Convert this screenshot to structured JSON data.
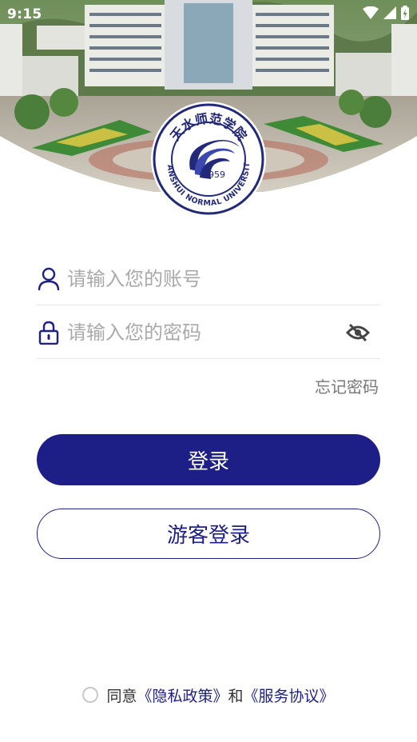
{
  "status_bar": {
    "time": "9:15"
  },
  "icons": {
    "status": [
      "wifi-icon",
      "cellular-signal-icon",
      "battery-charging-icon"
    ],
    "fields": [
      "user-icon",
      "lock-icon",
      "eye-off-icon"
    ]
  },
  "logo": {
    "chinese_name": "天水师范学院",
    "english_name": "TIANSHUI NORMAL UNIVERSITY",
    "year": "1959"
  },
  "form": {
    "account": {
      "value": "",
      "placeholder": "请输入您的账号"
    },
    "password": {
      "value": "",
      "placeholder": "请输入您的密码"
    },
    "forgot_label": "忘记密码",
    "login_label": "登录",
    "guest_login_label": "游客登录"
  },
  "agreement": {
    "checked": false,
    "prefix": "同意",
    "privacy_link": "《隐私政策》",
    "conjunction": "和",
    "service_link": "《服务协议》"
  },
  "colors": {
    "primary": "#1e1f86",
    "placeholder": "#a9a9a9",
    "divider": "#e6e6e6"
  }
}
